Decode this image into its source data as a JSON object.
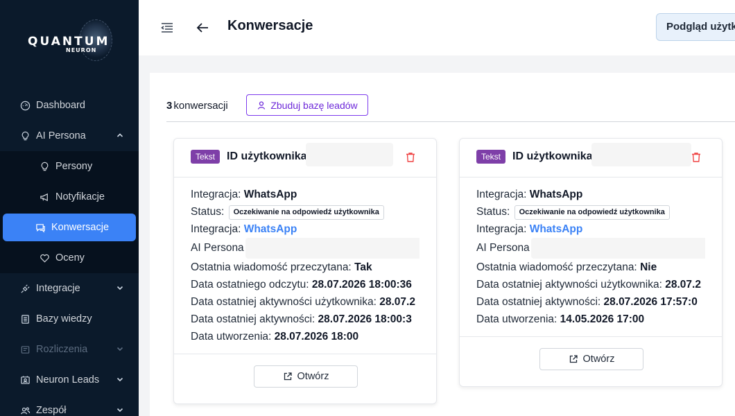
{
  "brand": {
    "name": "QUANTUM",
    "sub": "NEURON"
  },
  "sidebar": {
    "items": [
      {
        "label": "Dashboard",
        "icon": "gauge-icon"
      },
      {
        "label": "AI Persona",
        "icon": "lightbulb-icon",
        "expanded": true,
        "children": [
          {
            "label": "Persony",
            "icon": "lightbulb-icon"
          },
          {
            "label": "Notyfikacje",
            "icon": "megaphone-icon"
          },
          {
            "label": "Konwersacje",
            "icon": "chat-icon",
            "active": true
          },
          {
            "label": "Oceny",
            "icon": "heart-icon"
          }
        ]
      },
      {
        "label": "Integracje",
        "icon": "plug-icon"
      },
      {
        "label": "Bazy wiedzy",
        "icon": "book-icon"
      },
      {
        "label": "Rozliczenia",
        "icon": "receipt-icon",
        "disabled": true
      },
      {
        "label": "Neuron Leads",
        "icon": "contacts-icon"
      },
      {
        "label": "Zespół",
        "icon": "team-icon"
      }
    ]
  },
  "header": {
    "title": "Konwersacje",
    "preview_button": "Podgląd użytk"
  },
  "summary": {
    "count": "3",
    "count_label": "konwersacji",
    "leads_button": "Zbuduj bazę leadów"
  },
  "cards": [
    {
      "tag": "Tekst",
      "uid_label": "ID użytkownika",
      "integration_label": "Integracja:",
      "integration_value": "WhatsApp",
      "status_label": "Status:",
      "status_value": "Oczekiwanie na odpowiedź użytkownika",
      "integration2_label": "Integracja:",
      "integration2_value": "WhatsApp",
      "persona_label": "AI Persona",
      "read_label": "Ostatnia wiadomość przeczytana:",
      "read_value": "Tak",
      "last_read_label": "Data ostatniego odczytu:",
      "last_read_value": "28.07.2026 18:00:36",
      "user_activity_label": "Data ostatniej aktywności użytkownika:",
      "user_activity_value": "28.07.2",
      "activity_label": "Data ostatniej aktywności:",
      "activity_value": "28.07.2026 18:00:3",
      "created_label": "Data utworzenia:",
      "created_value": "28.07.2026 18:00",
      "open_button": "Otwórz"
    },
    {
      "tag": "Tekst",
      "uid_label": "ID użytkownika",
      "integration_label": "Integracja:",
      "integration_value": "WhatsApp",
      "status_label": "Status:",
      "status_value": "Oczekiwanie na odpowiedź użytkownika",
      "integration2_label": "Integracja:",
      "integration2_value": "WhatsApp",
      "persona_label": "AI Persona",
      "read_label": "Ostatnia wiadomość przeczytana:",
      "read_value": "Nie",
      "user_activity_label": "Data ostatniej aktywności użytkownika:",
      "user_activity_value": "28.07.2",
      "activity_label": "Data ostatniej aktywności:",
      "activity_value": "28.07.2026 17:57:0",
      "created_label": "Data utworzenia:",
      "created_value": "14.05.2026 17:00",
      "open_button": "Otwórz"
    }
  ],
  "colors": {
    "sidebar_bg": "#0b1a2b",
    "active": "#3b82f6",
    "tag": "#7e3fa8",
    "link": "#3b82f6",
    "danger": "#ef4444"
  }
}
